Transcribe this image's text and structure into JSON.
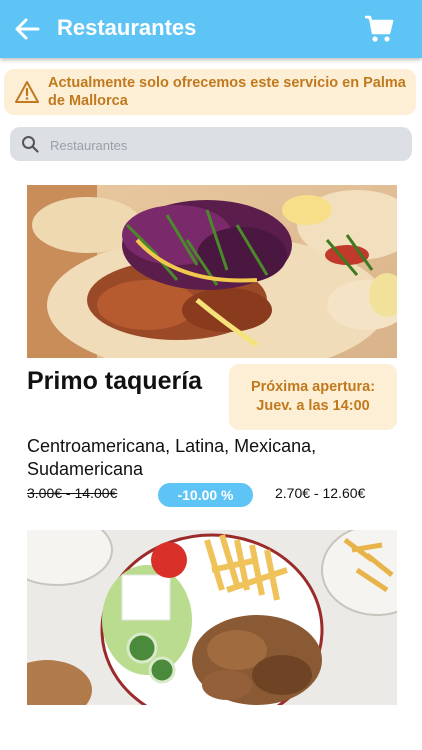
{
  "header": {
    "title": "Restaurantes",
    "back_icon": "arrow-left-icon",
    "cart_icon": "shopping-cart-icon",
    "color": "#5ec4f5"
  },
  "notice": {
    "text": "Actualmente solo ofrecemos este servicio en Palma de Mallorca",
    "icon": "warning-icon",
    "color": "#c07a1d",
    "background": "#fdeed6"
  },
  "search": {
    "placeholder": "Restaurantes",
    "value": "",
    "icon": "search-icon"
  },
  "restaurants": [
    {
      "name": "Primo taquería",
      "opening": "Próxima apertura: Juev. a las 14:00",
      "cuisines": "Centroamericana, Latina, Mexicana, Sudamericana",
      "old_price": "3.00€ - 14.00€",
      "discount": "-10.00 %",
      "new_price": "2.70€ - 12.60€"
    }
  ]
}
